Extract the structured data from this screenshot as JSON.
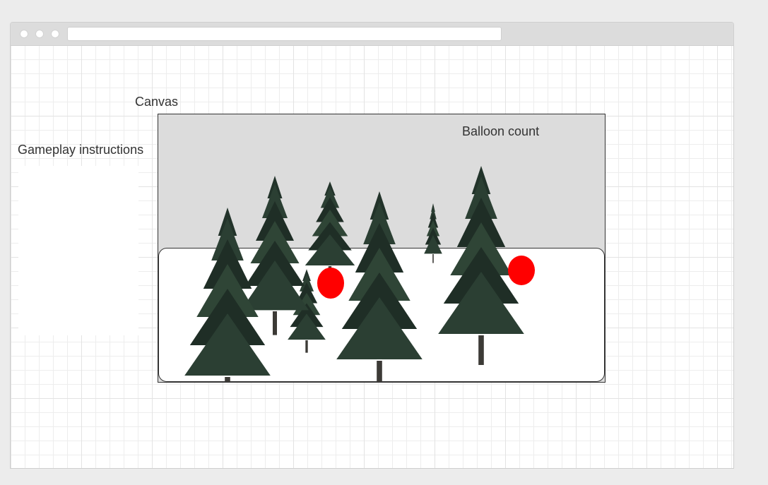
{
  "labels": {
    "canvas": "Canvas",
    "instructions": "Gameplay instructions",
    "balloon_count": "Balloon count"
  },
  "colors": {
    "balloon": "#ff0000",
    "sky": "#dcdcdc",
    "tree_dark": "#1f2e26",
    "tree_mid": "#2f4536",
    "trunk": "#3c3a36"
  },
  "scene": {
    "trees": 7,
    "balloons": 2
  }
}
